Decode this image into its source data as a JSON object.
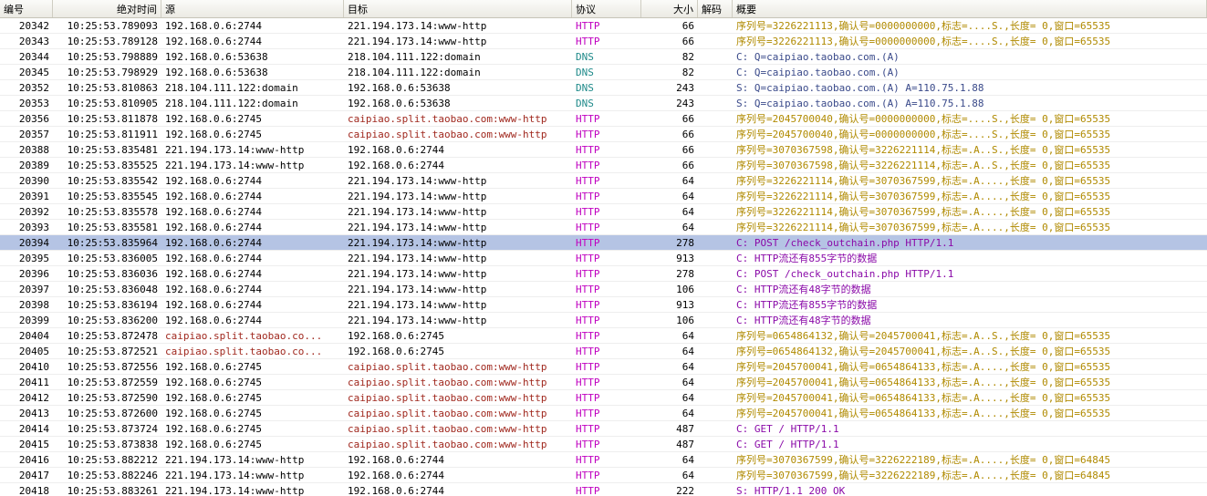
{
  "headers": {
    "no": "编号",
    "time": "绝对时间",
    "src": "源",
    "dst": "目标",
    "proto": "协议",
    "size": "大小",
    "decode": "解码",
    "summary": "概要"
  },
  "colors": {
    "address_red": "#a0281e",
    "http": "#c000c0",
    "dns": "#1f8a8a",
    "tcp_summary": "#b08a00",
    "dns_summary": "#3a4a8a",
    "http_summary": "#8a0aa8",
    "selection": "#b5c4e4"
  },
  "rows": [
    {
      "no": "20342",
      "time": "10:25:53.789093",
      "src": "192.168.0.6:2744",
      "dst": "221.194.173.14:www-http",
      "proto": "HTTP",
      "size": "66",
      "decode": "",
      "summary": "序列号=3226221113,确认号=0000000000,标志=....S.,长度=    0,窗口=65535",
      "src_cls": "",
      "dst_cls": "",
      "proto_cls": "mag",
      "sum_cls": "gold"
    },
    {
      "no": "20343",
      "time": "10:25:53.789128",
      "src": "192.168.0.6:2744",
      "dst": "221.194.173.14:www-http",
      "proto": "HTTP",
      "size": "66",
      "decode": "",
      "summary": "序列号=3226221113,确认号=0000000000,标志=....S.,长度=    0,窗口=65535",
      "src_cls": "",
      "dst_cls": "",
      "proto_cls": "mag",
      "sum_cls": "gold"
    },
    {
      "no": "20344",
      "time": "10:25:53.798889",
      "src": "192.168.0.6:53638",
      "dst": "218.104.111.122:domain",
      "proto": "DNS",
      "size": "82",
      "decode": "",
      "summary": "C: Q=caipiao.taobao.com.(A)",
      "src_cls": "",
      "dst_cls": "",
      "proto_cls": "teal",
      "sum_cls": "blue"
    },
    {
      "no": "20345",
      "time": "10:25:53.798929",
      "src": "192.168.0.6:53638",
      "dst": "218.104.111.122:domain",
      "proto": "DNS",
      "size": "82",
      "decode": "",
      "summary": "C: Q=caipiao.taobao.com.(A)",
      "src_cls": "",
      "dst_cls": "",
      "proto_cls": "teal",
      "sum_cls": "blue"
    },
    {
      "no": "20352",
      "time": "10:25:53.810863",
      "src": "218.104.111.122:domain",
      "dst": "192.168.0.6:53638",
      "proto": "DNS",
      "size": "243",
      "decode": "",
      "summary": "S: Q=caipiao.taobao.com.(A) A=110.75.1.88",
      "src_cls": "",
      "dst_cls": "",
      "proto_cls": "teal",
      "sum_cls": "blue"
    },
    {
      "no": "20353",
      "time": "10:25:53.810905",
      "src": "218.104.111.122:domain",
      "dst": "192.168.0.6:53638",
      "proto": "DNS",
      "size": "243",
      "decode": "",
      "summary": "S: Q=caipiao.taobao.com.(A) A=110.75.1.88",
      "src_cls": "",
      "dst_cls": "",
      "proto_cls": "teal",
      "sum_cls": "blue"
    },
    {
      "no": "20356",
      "time": "10:25:53.811878",
      "src": "192.168.0.6:2745",
      "dst": "caipiao.split.taobao.com:www-http",
      "proto": "HTTP",
      "size": "66",
      "decode": "",
      "summary": "序列号=2045700040,确认号=0000000000,标志=....S.,长度=    0,窗口=65535",
      "src_cls": "",
      "dst_cls": "red",
      "proto_cls": "mag",
      "sum_cls": "gold"
    },
    {
      "no": "20357",
      "time": "10:25:53.811911",
      "src": "192.168.0.6:2745",
      "dst": "caipiao.split.taobao.com:www-http",
      "proto": "HTTP",
      "size": "66",
      "decode": "",
      "summary": "序列号=2045700040,确认号=0000000000,标志=....S.,长度=    0,窗口=65535",
      "src_cls": "",
      "dst_cls": "red",
      "proto_cls": "mag",
      "sum_cls": "gold"
    },
    {
      "no": "20388",
      "time": "10:25:53.835481",
      "src": "221.194.173.14:www-http",
      "dst": "192.168.0.6:2744",
      "proto": "HTTP",
      "size": "66",
      "decode": "",
      "summary": "序列号=3070367598,确认号=3226221114,标志=.A..S.,长度=    0,窗口=65535",
      "src_cls": "",
      "dst_cls": "",
      "proto_cls": "mag",
      "sum_cls": "gold"
    },
    {
      "no": "20389",
      "time": "10:25:53.835525",
      "src": "221.194.173.14:www-http",
      "dst": "192.168.0.6:2744",
      "proto": "HTTP",
      "size": "66",
      "decode": "",
      "summary": "序列号=3070367598,确认号=3226221114,标志=.A..S.,长度=    0,窗口=65535",
      "src_cls": "",
      "dst_cls": "",
      "proto_cls": "mag",
      "sum_cls": "gold"
    },
    {
      "no": "20390",
      "time": "10:25:53.835542",
      "src": "192.168.0.6:2744",
      "dst": "221.194.173.14:www-http",
      "proto": "HTTP",
      "size": "64",
      "decode": "",
      "summary": "序列号=3226221114,确认号=3070367599,标志=.A....,长度=    0,窗口=65535",
      "src_cls": "",
      "dst_cls": "",
      "proto_cls": "mag",
      "sum_cls": "gold"
    },
    {
      "no": "20391",
      "time": "10:25:53.835545",
      "src": "192.168.0.6:2744",
      "dst": "221.194.173.14:www-http",
      "proto": "HTTP",
      "size": "64",
      "decode": "",
      "summary": "序列号=3226221114,确认号=3070367599,标志=.A....,长度=    0,窗口=65535",
      "src_cls": "",
      "dst_cls": "",
      "proto_cls": "mag",
      "sum_cls": "gold"
    },
    {
      "no": "20392",
      "time": "10:25:53.835578",
      "src": "192.168.0.6:2744",
      "dst": "221.194.173.14:www-http",
      "proto": "HTTP",
      "size": "64",
      "decode": "",
      "summary": "序列号=3226221114,确认号=3070367599,标志=.A....,长度=    0,窗口=65535",
      "src_cls": "",
      "dst_cls": "",
      "proto_cls": "mag",
      "sum_cls": "gold"
    },
    {
      "no": "20393",
      "time": "10:25:53.835581",
      "src": "192.168.0.6:2744",
      "dst": "221.194.173.14:www-http",
      "proto": "HTTP",
      "size": "64",
      "decode": "",
      "summary": "序列号=3226221114,确认号=3070367599,标志=.A....,长度=    0,窗口=65535",
      "src_cls": "",
      "dst_cls": "",
      "proto_cls": "mag",
      "sum_cls": "gold"
    },
    {
      "no": "20394",
      "time": "10:25:53.835964",
      "src": "192.168.0.6:2744",
      "dst": "221.194.173.14:www-http",
      "proto": "HTTP",
      "size": "278",
      "decode": "",
      "summary": "C: POST /check_outchain.php HTTP/1.1",
      "src_cls": "",
      "dst_cls": "",
      "proto_cls": "mag",
      "sum_cls": "purp",
      "selected": true
    },
    {
      "no": "20395",
      "time": "10:25:53.836005",
      "src": "192.168.0.6:2744",
      "dst": "221.194.173.14:www-http",
      "proto": "HTTP",
      "size": "913",
      "decode": "",
      "summary": "C: HTTP流还有855字节的数据",
      "src_cls": "",
      "dst_cls": "",
      "proto_cls": "mag",
      "sum_cls": "purp"
    },
    {
      "no": "20396",
      "time": "10:25:53.836036",
      "src": "192.168.0.6:2744",
      "dst": "221.194.173.14:www-http",
      "proto": "HTTP",
      "size": "278",
      "decode": "",
      "summary": "C: POST /check_outchain.php HTTP/1.1",
      "src_cls": "",
      "dst_cls": "",
      "proto_cls": "mag",
      "sum_cls": "purp"
    },
    {
      "no": "20397",
      "time": "10:25:53.836048",
      "src": "192.168.0.6:2744",
      "dst": "221.194.173.14:www-http",
      "proto": "HTTP",
      "size": "106",
      "decode": "",
      "summary": "C: HTTP流还有48字节的数据",
      "src_cls": "",
      "dst_cls": "",
      "proto_cls": "mag",
      "sum_cls": "purp"
    },
    {
      "no": "20398",
      "time": "10:25:53.836194",
      "src": "192.168.0.6:2744",
      "dst": "221.194.173.14:www-http",
      "proto": "HTTP",
      "size": "913",
      "decode": "",
      "summary": "C: HTTP流还有855字节的数据",
      "src_cls": "",
      "dst_cls": "",
      "proto_cls": "mag",
      "sum_cls": "purp"
    },
    {
      "no": "20399",
      "time": "10:25:53.836200",
      "src": "192.168.0.6:2744",
      "dst": "221.194.173.14:www-http",
      "proto": "HTTP",
      "size": "106",
      "decode": "",
      "summary": "C: HTTP流还有48字节的数据",
      "src_cls": "",
      "dst_cls": "",
      "proto_cls": "mag",
      "sum_cls": "purp"
    },
    {
      "no": "20404",
      "time": "10:25:53.872478",
      "src": "caipiao.split.taobao.co...",
      "dst": "192.168.0.6:2745",
      "proto": "HTTP",
      "size": "64",
      "decode": "",
      "summary": "序列号=0654864132,确认号=2045700041,标志=.A..S.,长度=    0,窗口=65535",
      "src_cls": "red",
      "dst_cls": "",
      "proto_cls": "mag",
      "sum_cls": "gold"
    },
    {
      "no": "20405",
      "time": "10:25:53.872521",
      "src": "caipiao.split.taobao.co...",
      "dst": "192.168.0.6:2745",
      "proto": "HTTP",
      "size": "64",
      "decode": "",
      "summary": "序列号=0654864132,确认号=2045700041,标志=.A..S.,长度=    0,窗口=65535",
      "src_cls": "red",
      "dst_cls": "",
      "proto_cls": "mag",
      "sum_cls": "gold"
    },
    {
      "no": "20410",
      "time": "10:25:53.872556",
      "src": "192.168.0.6:2745",
      "dst": "caipiao.split.taobao.com:www-http",
      "proto": "HTTP",
      "size": "64",
      "decode": "",
      "summary": "序列号=2045700041,确认号=0654864133,标志=.A....,长度=    0,窗口=65535",
      "src_cls": "",
      "dst_cls": "red",
      "proto_cls": "mag",
      "sum_cls": "gold"
    },
    {
      "no": "20411",
      "time": "10:25:53.872559",
      "src": "192.168.0.6:2745",
      "dst": "caipiao.split.taobao.com:www-http",
      "proto": "HTTP",
      "size": "64",
      "decode": "",
      "summary": "序列号=2045700041,确认号=0654864133,标志=.A....,长度=    0,窗口=65535",
      "src_cls": "",
      "dst_cls": "red",
      "proto_cls": "mag",
      "sum_cls": "gold"
    },
    {
      "no": "20412",
      "time": "10:25:53.872590",
      "src": "192.168.0.6:2745",
      "dst": "caipiao.split.taobao.com:www-http",
      "proto": "HTTP",
      "size": "64",
      "decode": "",
      "summary": "序列号=2045700041,确认号=0654864133,标志=.A....,长度=    0,窗口=65535",
      "src_cls": "",
      "dst_cls": "red",
      "proto_cls": "mag",
      "sum_cls": "gold"
    },
    {
      "no": "20413",
      "time": "10:25:53.872600",
      "src": "192.168.0.6:2745",
      "dst": "caipiao.split.taobao.com:www-http",
      "proto": "HTTP",
      "size": "64",
      "decode": "",
      "summary": "序列号=2045700041,确认号=0654864133,标志=.A....,长度=    0,窗口=65535",
      "src_cls": "",
      "dst_cls": "red",
      "proto_cls": "mag",
      "sum_cls": "gold"
    },
    {
      "no": "20414",
      "time": "10:25:53.873724",
      "src": "192.168.0.6:2745",
      "dst": "caipiao.split.taobao.com:www-http",
      "proto": "HTTP",
      "size": "487",
      "decode": "",
      "summary": "C: GET / HTTP/1.1",
      "src_cls": "",
      "dst_cls": "red",
      "proto_cls": "mag",
      "sum_cls": "purp"
    },
    {
      "no": "20415",
      "time": "10:25:53.873838",
      "src": "192.168.0.6:2745",
      "dst": "caipiao.split.taobao.com:www-http",
      "proto": "HTTP",
      "size": "487",
      "decode": "",
      "summary": "C: GET / HTTP/1.1",
      "src_cls": "",
      "dst_cls": "red",
      "proto_cls": "mag",
      "sum_cls": "purp"
    },
    {
      "no": "20416",
      "time": "10:25:53.882212",
      "src": "221.194.173.14:www-http",
      "dst": "192.168.0.6:2744",
      "proto": "HTTP",
      "size": "64",
      "decode": "",
      "summary": "序列号=3070367599,确认号=3226222189,标志=.A....,长度=    0,窗口=64845",
      "src_cls": "",
      "dst_cls": "",
      "proto_cls": "mag",
      "sum_cls": "gold"
    },
    {
      "no": "20417",
      "time": "10:25:53.882246",
      "src": "221.194.173.14:www-http",
      "dst": "192.168.0.6:2744",
      "proto": "HTTP",
      "size": "64",
      "decode": "",
      "summary": "序列号=3070367599,确认号=3226222189,标志=.A....,长度=    0,窗口=64845",
      "src_cls": "",
      "dst_cls": "",
      "proto_cls": "mag",
      "sum_cls": "gold"
    },
    {
      "no": "20418",
      "time": "10:25:53.883261",
      "src": "221.194.173.14:www-http",
      "dst": "192.168.0.6:2744",
      "proto": "HTTP",
      "size": "222",
      "decode": "",
      "summary": "S: HTTP/1.1 200 OK",
      "src_cls": "",
      "dst_cls": "",
      "proto_cls": "mag",
      "sum_cls": "purp"
    }
  ]
}
